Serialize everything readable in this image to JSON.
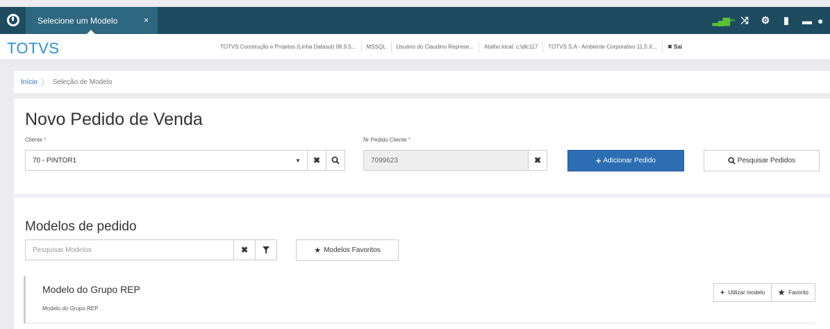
{
  "topbar": {
    "tab_label": "Selecione um Modelo",
    "tab_close": "×",
    "icons": [
      "signal-icon",
      "shuffle-icon",
      "gear-icon",
      "document-icon",
      "chat-icon",
      "help-icon"
    ],
    "signal_text": "on"
  },
  "infobar": {
    "brand": "TOTVS",
    "items": [
      "TOTVS Construção e Projetos (Linha Datasul) 06.9.5...",
      "MSSQL",
      "Usuário do Claudino Represe...",
      "Atalho local: c:\\dlc117",
      "TOTVS S.A - Ambiente Corporativo 11.5.X...",
      "✖ Sai"
    ]
  },
  "breadcrumb": {
    "home": "Início",
    "separator": "〉",
    "current": "Seleção de Modelo"
  },
  "form": {
    "title": "Novo Pedido de Venda",
    "cliente_label": "Cliente",
    "cliente_value": "70 - PINTOR1",
    "nr_pedido_label": "Nr Pedido Cliente",
    "nr_pedido_value": "7099623",
    "required_mark": "*",
    "add_button": "Adicionar Pedido",
    "search_button": "Pesquisar Pedidos"
  },
  "models": {
    "title": "Modelos de pedido",
    "search_placeholder": "Pesquisar Modelos",
    "favorites_button": "Modelos Favoritos",
    "items": [
      {
        "name": "Modelo do Grupo REP",
        "description": "Modelo do Grupo REP",
        "use_button": "Utilizar modelo",
        "favorite_button": "Favorito"
      }
    ]
  },
  "colors": {
    "topbar": "#1e4b60",
    "tab_active": "#2d6780",
    "brand": "#2a8fd6",
    "primary": "#2d6db4"
  }
}
